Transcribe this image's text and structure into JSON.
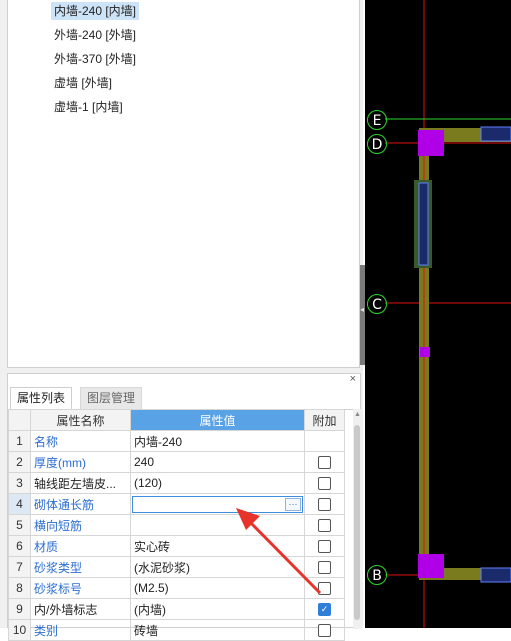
{
  "tree": {
    "items": [
      {
        "label": "内墙-240 [内墙]",
        "selected": true
      },
      {
        "label": "外墙-240 [外墙]",
        "selected": false
      },
      {
        "label": "外墙-370 [外墙]",
        "selected": false
      },
      {
        "label": "虚墙 [外墙]",
        "selected": false
      },
      {
        "label": "虚墙-1 [内墙]",
        "selected": false
      }
    ]
  },
  "panel": {
    "close_label": "×",
    "tabs": [
      {
        "label": "属性列表",
        "active": true
      },
      {
        "label": "图层管理",
        "active": false
      }
    ],
    "columns": {
      "name": "属性名称",
      "value": "属性值",
      "extra": "附加"
    },
    "rows": [
      {
        "num": "1",
        "name": "名称",
        "value": "内墙-240",
        "checkbox": "none",
        "blue": true
      },
      {
        "num": "2",
        "name": "厚度(mm)",
        "value": "240",
        "checkbox": "off",
        "blue": true
      },
      {
        "num": "3",
        "name": "轴线距左墙皮...",
        "value": "(120)",
        "checkbox": "off",
        "blue": false
      },
      {
        "num": "4",
        "name": "砌体通长筋",
        "value": "",
        "checkbox": "off",
        "blue": true,
        "editing": true,
        "edit_button": "···"
      },
      {
        "num": "5",
        "name": "横向短筋",
        "value": "",
        "checkbox": "off",
        "blue": true
      },
      {
        "num": "6",
        "name": "材质",
        "value": "实心砖",
        "checkbox": "off",
        "blue": true
      },
      {
        "num": "7",
        "name": "砂浆类型",
        "value": "(水泥砂浆)",
        "checkbox": "off",
        "blue": true
      },
      {
        "num": "8",
        "name": "砂浆标号",
        "value": "(M2.5)",
        "checkbox": "off",
        "blue": true
      },
      {
        "num": "9",
        "name": "内/外墙标志",
        "value": "(内墙)",
        "checkbox": "on",
        "blue": false
      },
      {
        "num": "10",
        "name": "类别",
        "value": "砖墙",
        "checkbox": "off",
        "blue": true
      }
    ]
  },
  "cad": {
    "axes": [
      "E",
      "D",
      "C",
      "B"
    ],
    "colors": {
      "background": "#000000",
      "wall": "#7a7a1e",
      "column": "#b000e8",
      "axis_line": "#e01010",
      "grid_circle": "#2ed52e",
      "annotation_arrow": "#e8332a"
    }
  }
}
